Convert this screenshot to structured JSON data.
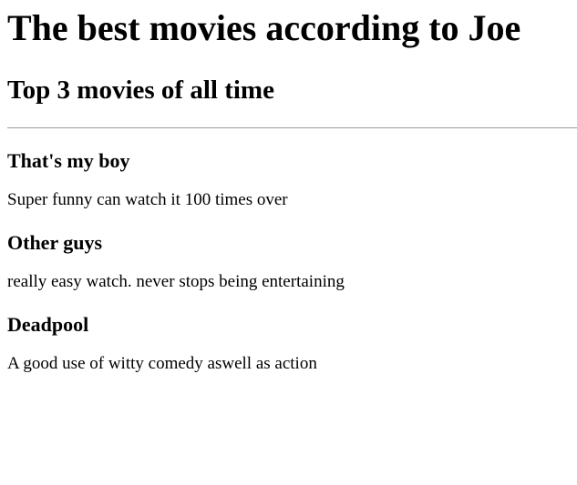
{
  "page": {
    "title": "The best movies according to Joe",
    "subtitle": "Top 3 movies of all time"
  },
  "movies": [
    {
      "title": "That's my boy",
      "description": "Super funny can watch it 100 times over"
    },
    {
      "title": "Other guys",
      "description": "really easy watch. never stops being entertaining"
    },
    {
      "title": "Deadpool",
      "description": "A good use of witty comedy aswell as action"
    }
  ]
}
